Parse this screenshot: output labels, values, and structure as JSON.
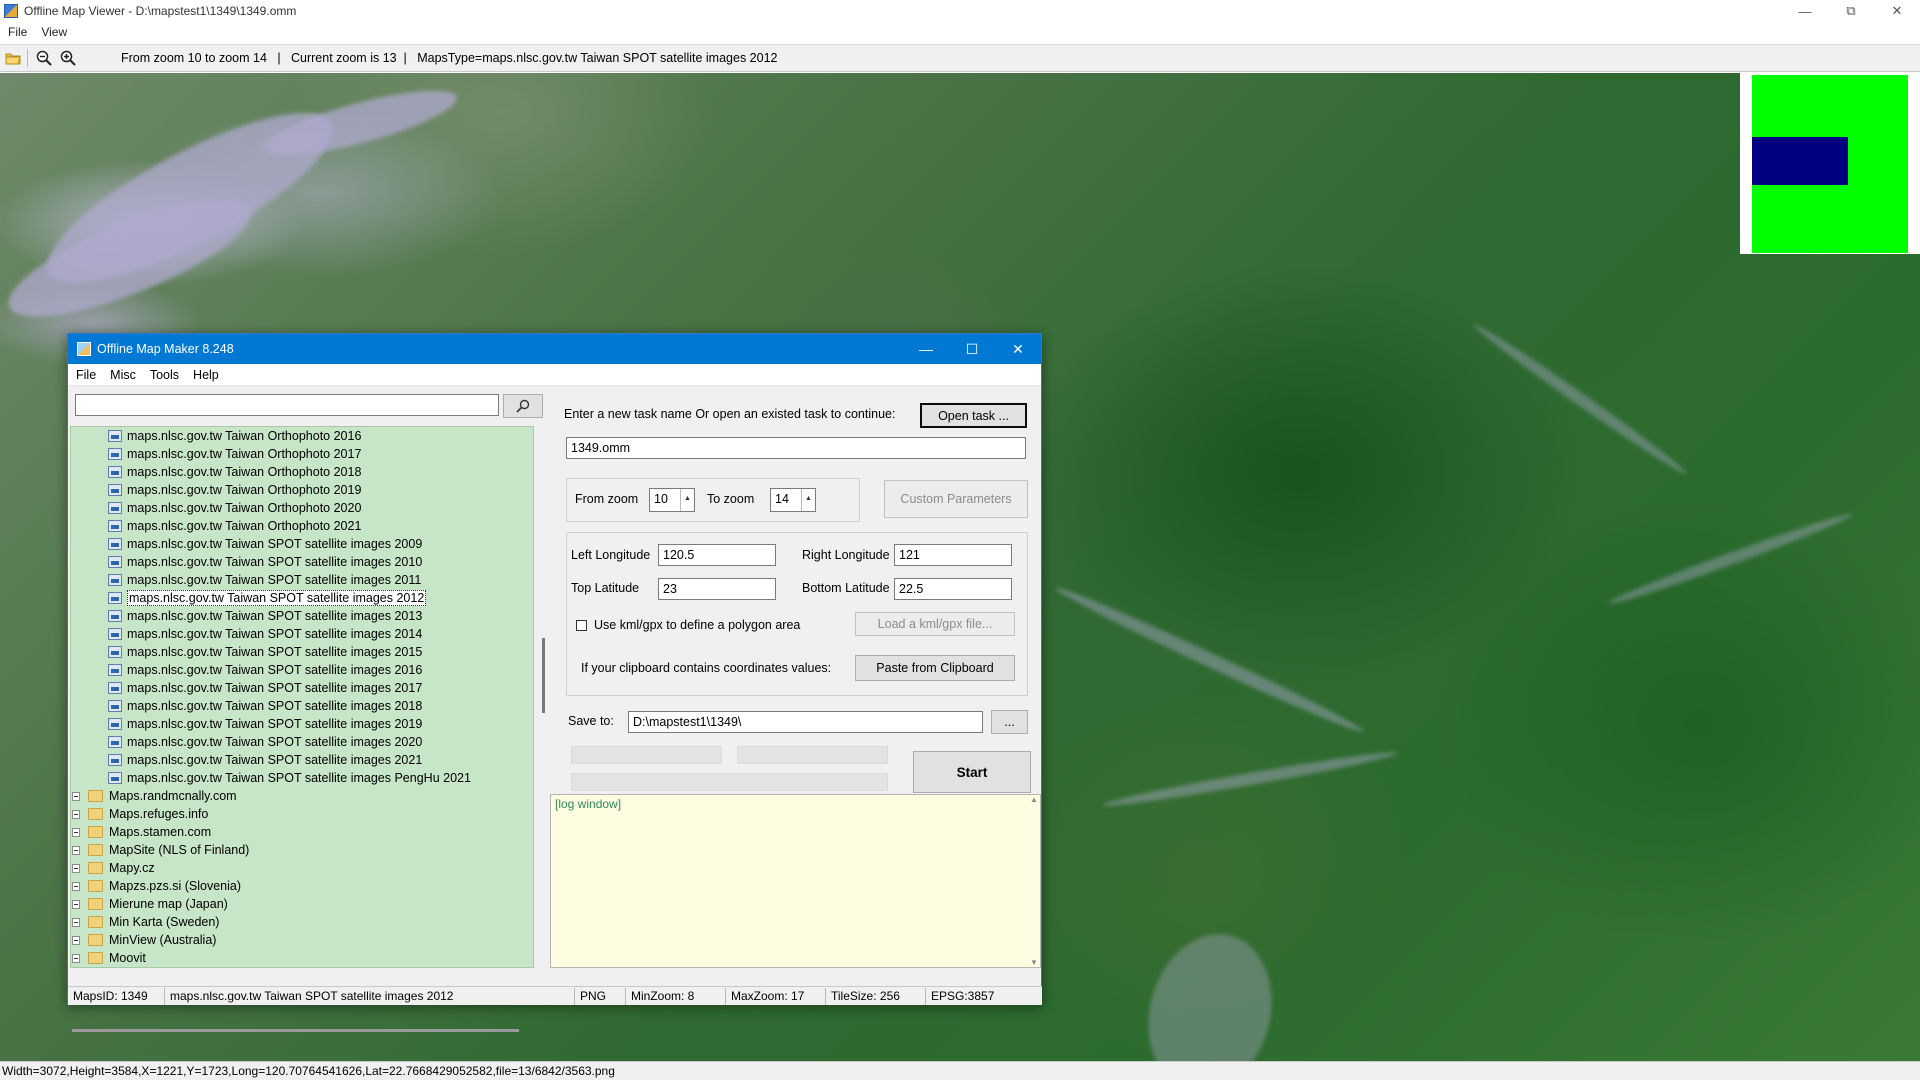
{
  "window": {
    "title": "Offline Map Viewer - D:\\mapstest1\\1349\\1349.omm"
  },
  "menu": [
    "File",
    "View"
  ],
  "toolbar": {
    "zoom_range": "From zoom 10 to zoom 14",
    "sep1": "   |   ",
    "current_zoom": "Current zoom is 13",
    "sep2": "  |   ",
    "maps_type": "MapsType=maps.nlsc.gov.tw Taiwan SPOT satellite images 2012"
  },
  "statusbar": {
    "text": "Width=3072,Height=3584,X=1221,Y=1723,Long=120.70764541626,Lat=22.7668429052582,file=13/6842/3563.png"
  },
  "overview": {
    "frame_color": "#00ff00",
    "viewport_color": "#000080"
  },
  "dialog": {
    "title": "Offline Map Maker 8.248",
    "menu": [
      "File",
      "Misc",
      "Tools",
      "Help"
    ],
    "search": {
      "value": ""
    },
    "tree": {
      "children": [
        "maps.nlsc.gov.tw Taiwan Orthophoto 2016",
        "maps.nlsc.gov.tw Taiwan Orthophoto 2017",
        "maps.nlsc.gov.tw Taiwan Orthophoto 2018",
        "maps.nlsc.gov.tw Taiwan Orthophoto 2019",
        "maps.nlsc.gov.tw Taiwan Orthophoto 2020",
        "maps.nlsc.gov.tw Taiwan Orthophoto 2021",
        "maps.nlsc.gov.tw Taiwan SPOT satellite images 2009",
        "maps.nlsc.gov.tw Taiwan SPOT satellite images 2010",
        "maps.nlsc.gov.tw Taiwan SPOT satellite images 2011",
        "maps.nlsc.gov.tw Taiwan SPOT satellite images 2012",
        "maps.nlsc.gov.tw Taiwan SPOT satellite images 2013",
        "maps.nlsc.gov.tw Taiwan SPOT satellite images 2014",
        "maps.nlsc.gov.tw Taiwan SPOT satellite images 2015",
        "maps.nlsc.gov.tw Taiwan SPOT satellite images 2016",
        "maps.nlsc.gov.tw Taiwan SPOT satellite images 2017",
        "maps.nlsc.gov.tw Taiwan SPOT satellite images 2018",
        "maps.nlsc.gov.tw Taiwan SPOT satellite images 2019",
        "maps.nlsc.gov.tw Taiwan SPOT satellite images 2020",
        "maps.nlsc.gov.tw Taiwan SPOT satellite images 2021",
        "maps.nlsc.gov.tw Taiwan SPOT satellite images PengHu 2021"
      ],
      "selected": "maps.nlsc.gov.tw Taiwan SPOT satellite images 2012",
      "folders": [
        "Maps.randmcnally.com",
        "Maps.refuges.info",
        "Maps.stamen.com",
        "MapSite (NLS of Finland)",
        "Mapy.cz",
        "Mapzs.pzs.si (Slovenia)",
        "Mierune map (Japan)",
        "Min Karta (Sweden)",
        "MinView (Australia)",
        "Moovit"
      ]
    },
    "task": {
      "prompt": "Enter a new task name Or open an existed task to continue:",
      "open_button": "Open task ...",
      "name": "1349.omm"
    },
    "zoom": {
      "from_label": "From zoom",
      "from_value": "10",
      "to_label": "To zoom",
      "to_value": "14",
      "custom_button": "Custom Parameters"
    },
    "coords": {
      "left_long_label": "Left Longitude",
      "left_long": "120.5",
      "right_long_label": "Right Longitude",
      "right_long": "121",
      "top_lat_label": "Top Latitude",
      "top_lat": "23",
      "bottom_lat_label": "Bottom Latitude",
      "bottom_lat": "22.5",
      "kml_checkbox_label": "Use kml/gpx to define a polygon area",
      "kml_checked": false,
      "kml_button": "Load a kml/gpx file...",
      "clipboard_label": "If your clipboard contains coordinates values:",
      "clipboard_button": "Paste from Clipboard"
    },
    "save": {
      "label": "Save to:",
      "path": "D:\\mapstest1\\1349\\",
      "browse_button": "...",
      "start_button": "Start"
    },
    "log": {
      "text": "[log window]"
    },
    "status": {
      "maps_id": "MapsID: 1349",
      "maps_name": "maps.nlsc.gov.tw Taiwan SPOT satellite images 2012",
      "format": "PNG",
      "min_zoom": "MinZoom: 8",
      "max_zoom": "MaxZoom: 17",
      "tile_size": "TileSize: 256",
      "epsg": "EPSG:3857"
    }
  }
}
